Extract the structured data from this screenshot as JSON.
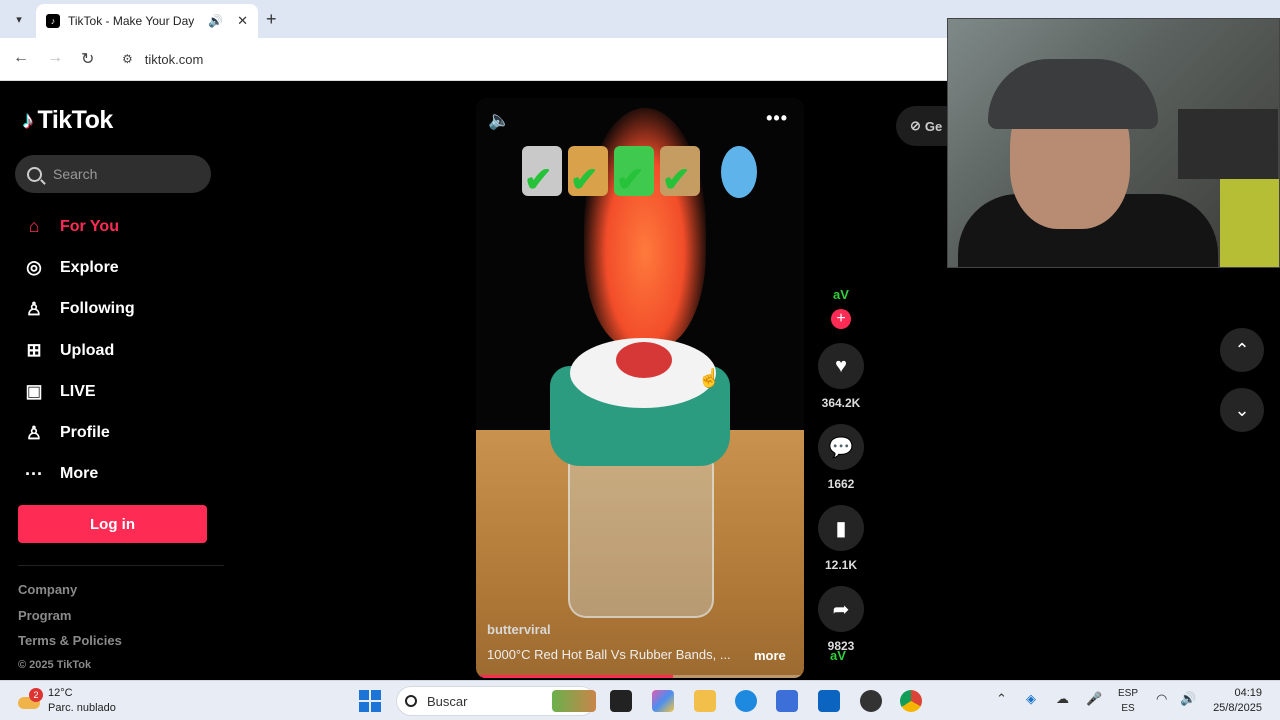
{
  "browser": {
    "tab_title": "TikTok - Make Your Day",
    "url": "tikto k.com"
  },
  "sidebar": {
    "logo": "TikTok",
    "search_placeholder": "Search",
    "nav": [
      {
        "label": "For You",
        "icon": "home-icon",
        "active": true
      },
      {
        "label": "Explore",
        "icon": "compass-icon"
      },
      {
        "label": "Following",
        "icon": "following-icon"
      },
      {
        "label": "Upload",
        "icon": "upload-icon"
      },
      {
        "label": "LIVE",
        "icon": "live-icon"
      },
      {
        "label": "Profile",
        "icon": "profile-icon"
      },
      {
        "label": "More",
        "icon": "more-icon"
      }
    ],
    "login": "Log in",
    "footer": [
      "Company",
      "Program",
      "Terms & Policies"
    ],
    "copyright": "© 2025 TikTok"
  },
  "video": {
    "author": "butterviral",
    "caption": "1000°C Red Hot Ball Vs Rubber Bands, ...",
    "more": "more",
    "progress": 0.6
  },
  "actions": {
    "avatar": "aV",
    "likes": "364.2K",
    "comments": "1662",
    "saves": "12.1K",
    "shares": "9823"
  },
  "get_app": "Ge",
  "taskbar": {
    "temp": "12°C",
    "weather": "Parc. nublado",
    "weather_badge": "2",
    "search": "Buscar",
    "lang1": "ESP",
    "lang2": "ES",
    "time": "04:19",
    "date": "25/8/2025"
  },
  "colors": {
    "accent": "#fe2c55",
    "background": "#000000"
  }
}
